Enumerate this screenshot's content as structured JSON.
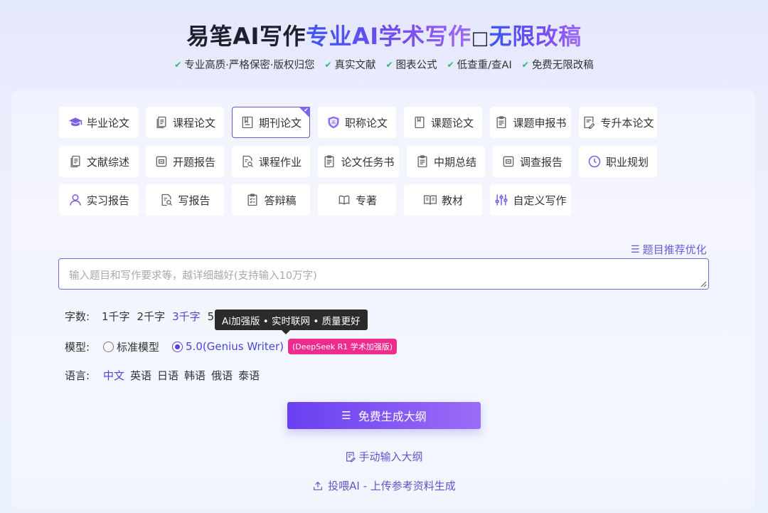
{
  "header": {
    "title_part1": "易笔AI写作",
    "title_part2": "专业AI学术写作",
    "title_separator": "□",
    "title_part3": "无限改稿",
    "features": [
      "专业高质·严格保密·版权归您",
      "真实文献",
      "图表公式",
      "低查重/查AI",
      "免费无限改稿"
    ]
  },
  "types": [
    {
      "label": "毕业论文",
      "icon": "graduation-cap-icon",
      "selected": false
    },
    {
      "label": "课程论文",
      "icon": "document-icon",
      "selected": false
    },
    {
      "label": "期刊论文",
      "icon": "journal-icon",
      "selected": true
    },
    {
      "label": "职称论文",
      "icon": "shield-badge-icon",
      "selected": false
    },
    {
      "label": "课题论文",
      "icon": "bookmark-doc-icon",
      "selected": false
    },
    {
      "label": "课题申报书",
      "icon": "clipboard-icon",
      "selected": false
    },
    {
      "label": "专升本论文",
      "icon": "doc-edit-icon",
      "selected": false
    },
    {
      "label": "文献综述",
      "icon": "documents-icon",
      "selected": false
    },
    {
      "label": "开题报告",
      "icon": "report-icon",
      "selected": false
    },
    {
      "label": "课程作业",
      "icon": "doc-search-icon",
      "selected": false
    },
    {
      "label": "论文任务书",
      "icon": "task-clipboard-icon",
      "selected": false
    },
    {
      "label": "中期总结",
      "icon": "summary-clipboard-icon",
      "selected": false
    },
    {
      "label": "调查报告",
      "icon": "survey-icon",
      "selected": false
    },
    {
      "label": "职业规划",
      "icon": "clock-icon",
      "selected": false
    },
    {
      "label": "实习报告",
      "icon": "person-icon",
      "selected": false
    },
    {
      "label": "写报告",
      "icon": "write-report-icon",
      "selected": false
    },
    {
      "label": "答辩稿",
      "icon": "checklist-icon",
      "selected": false
    },
    {
      "label": "专著",
      "icon": "book-icon",
      "selected": false
    },
    {
      "label": "教材",
      "icon": "open-book-icon",
      "selected": false
    },
    {
      "label": "自定义写作",
      "icon": "sliders-icon",
      "selected": false
    }
  ],
  "recommend_link": "题目推荐优化",
  "topic_input": {
    "placeholder": "输入题目和写作要求等，越详细越好(支持输入10万字)",
    "value": ""
  },
  "word_count": {
    "label": "字数:",
    "options": [
      "1千字",
      "2千字",
      "3千字",
      "5千字"
    ],
    "selected": "3千字"
  },
  "model": {
    "label": "模型:",
    "options": [
      "标准模型",
      "5.0(Genius Writer)"
    ],
    "selected": "5.0(Genius Writer)",
    "badge": "(DeepSeek R1 学术加强版)",
    "tooltip": "Ai加强版 • 实时联网 • 质量更好"
  },
  "language": {
    "label": "语言:",
    "options": [
      "中文",
      "英语",
      "日语",
      "韩语",
      "俄语",
      "泰语"
    ],
    "selected": "中文"
  },
  "generate_button": "免费生成大纲",
  "manual_link": "手动输入大纲",
  "upload_link": "投喂AI - 上传参考资料生成",
  "colors": {
    "accent": "#6a3ff0",
    "accent_light": "#9a6df6",
    "badge": "#f02b8e",
    "check": "#2bb673"
  }
}
